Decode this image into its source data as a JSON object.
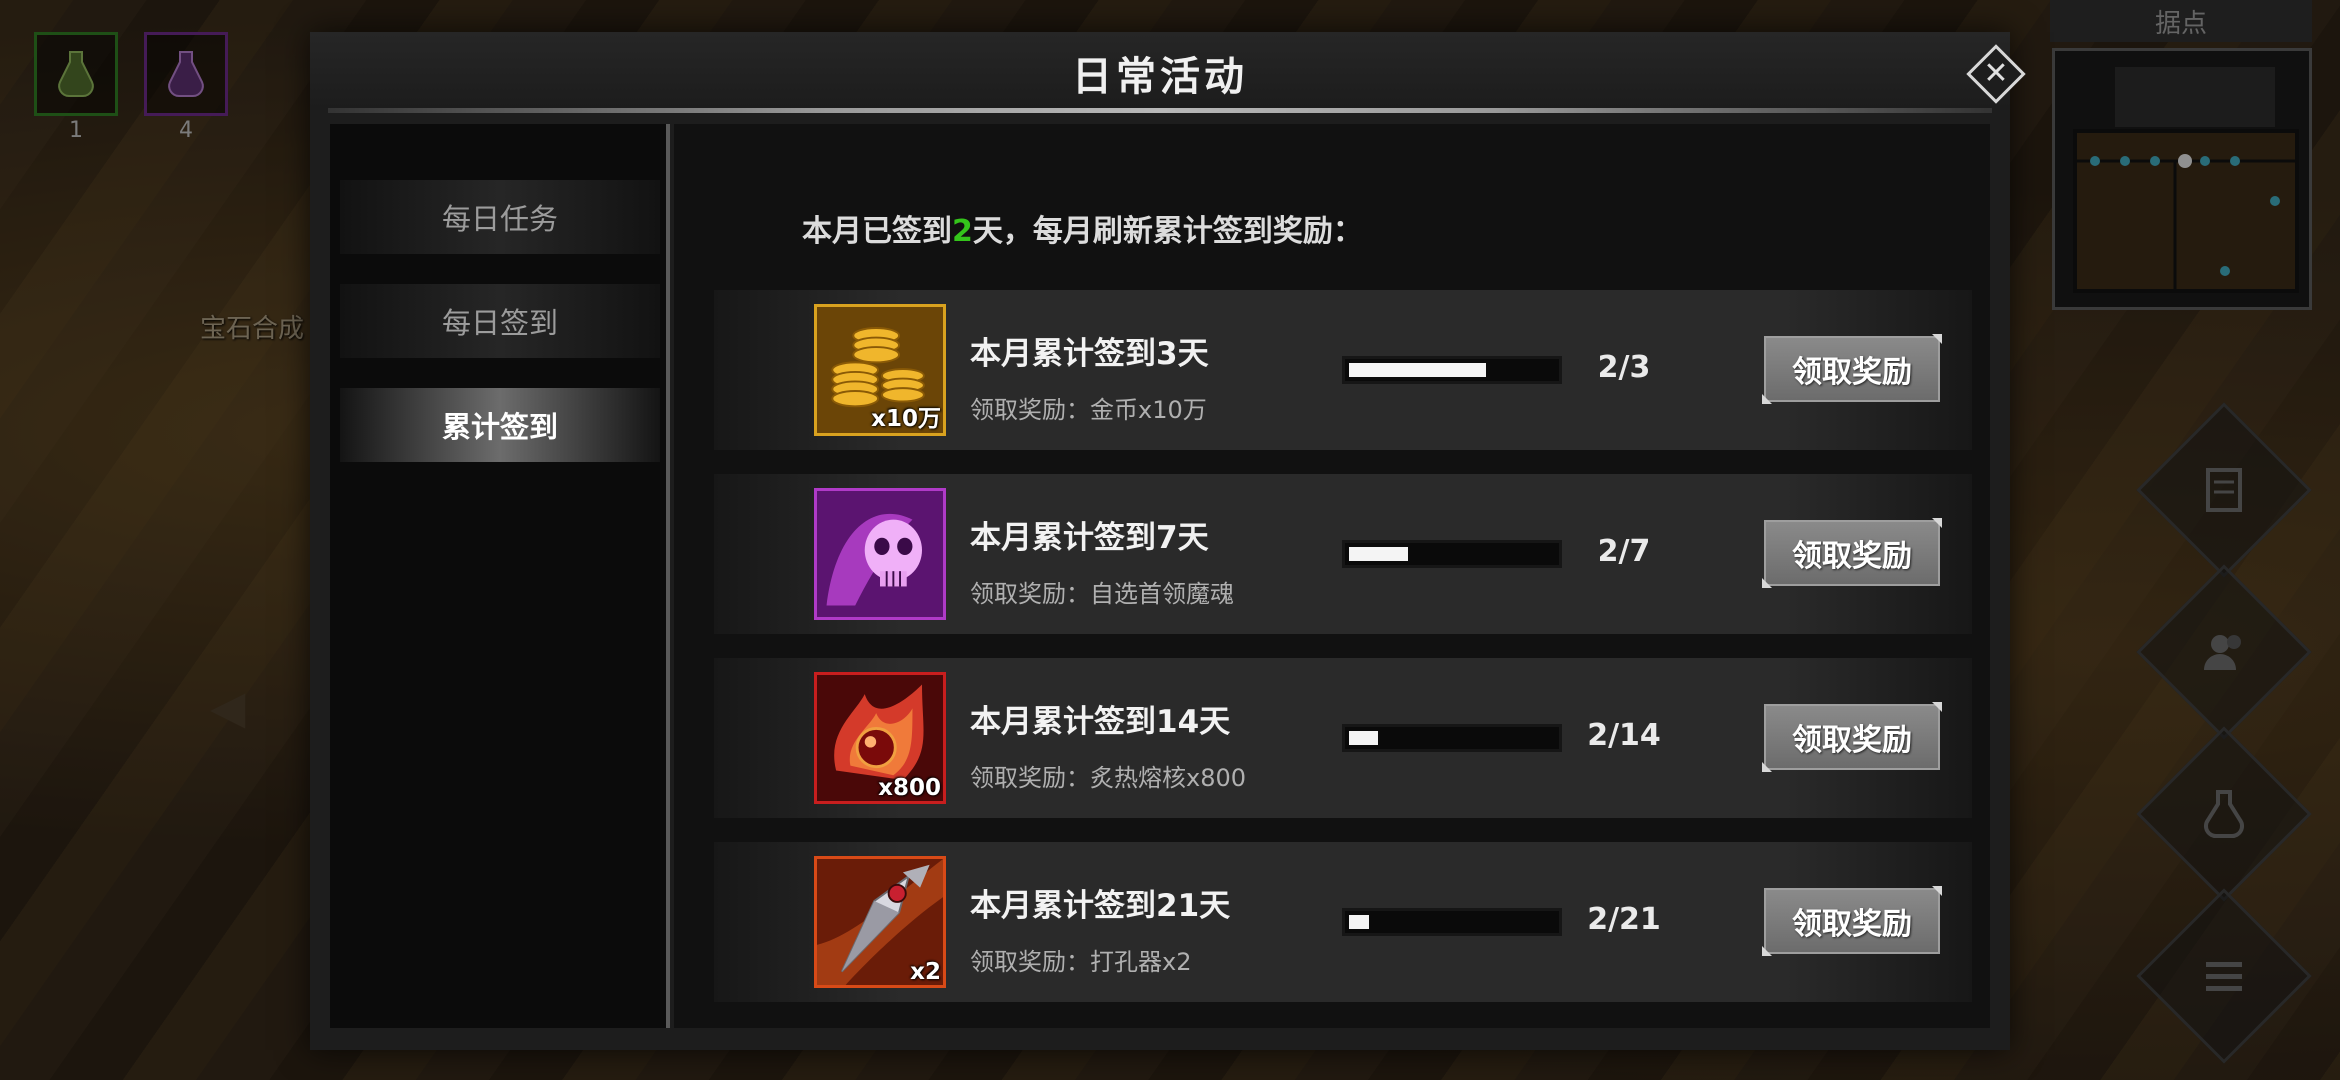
{
  "dialog": {
    "title": "日常活动"
  },
  "tabs": [
    {
      "label": "每日任务",
      "active": false
    },
    {
      "label": "每日签到",
      "active": false
    },
    {
      "label": "累计签到",
      "active": true
    }
  ],
  "summary": {
    "prefix": "本月已签到",
    "days": "2",
    "suffix": "天，每月刷新累计签到奖励："
  },
  "rewards": [
    {
      "title": "本月累计签到3天",
      "reward": "领取奖励：金币x10万",
      "qty": "x10万",
      "progress_text": "2/3",
      "progress": 0.6667,
      "button": "领取奖励",
      "icon": "gold-coins-icon"
    },
    {
      "title": "本月累计签到7天",
      "reward": "领取奖励：自选首领魔魂",
      "qty": "",
      "progress_text": "2/7",
      "progress": 0.2857,
      "button": "领取奖励",
      "icon": "purple-skull-soul-icon"
    },
    {
      "title": "本月累计签到14天",
      "reward": "领取奖励：炙热熔核x800",
      "qty": "x800",
      "progress_text": "2/14",
      "progress": 0.1429,
      "button": "领取奖励",
      "icon": "fire-core-icon"
    },
    {
      "title": "本月累计签到21天",
      "reward": "领取奖励：打孔器x2",
      "qty": "x2",
      "progress_text": "2/21",
      "progress": 0.0952,
      "button": "领取奖励",
      "icon": "drill-blade-icon"
    }
  ],
  "background": {
    "slots": [
      {
        "count": "1",
        "icon": "potion-icon-green"
      },
      {
        "count": "4",
        "icon": "potion-icon-purple"
      }
    ],
    "npc_label": "宝石合成",
    "minimap_title": "据点",
    "side_buttons": [
      "quest-icon",
      "friends-icon",
      "potion-icon",
      "menu-icon"
    ]
  },
  "colors": {
    "highlight": "#34c51b",
    "icon_borders": [
      "#d9a21f",
      "#b03ac8",
      "#c81e1e",
      "#d84a17"
    ]
  }
}
